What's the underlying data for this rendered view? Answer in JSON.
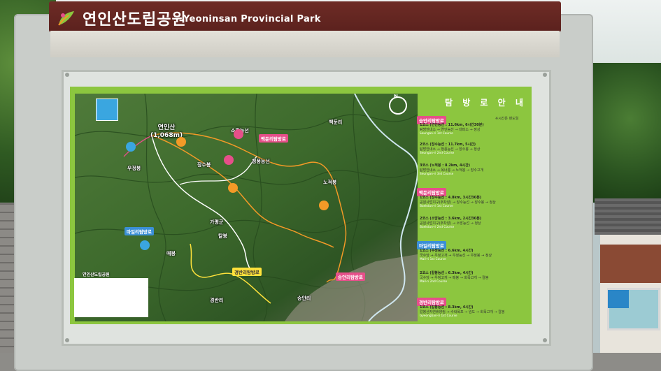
{
  "sign": {
    "title_ko": "연인산도립공원",
    "title_en": "Yeoninsan Provincial Park"
  },
  "map": {
    "peak_name": "연인산",
    "peak_height": "(1,068m)",
    "compass_n": "N",
    "labels": [
      "가평군",
      "경반리",
      "승안리",
      "백둔리",
      "우정봉",
      "매봉",
      "칼봉",
      "장수봉",
      "노적봉",
      "소망능선",
      "청풍능선"
    ],
    "trail_tags": [
      "승안리탐방로",
      "백둔리탐방로",
      "마일리탐방로",
      "경반리탐방로"
    ],
    "desc_title": "연인산도립공원"
  },
  "guide": {
    "title": "탐 방 로 안 내",
    "note": "※시간은 편도임",
    "sections": [
      {
        "tag": "승안리탐방로",
        "courses": [
          {
            "head": "1코스 (연인능선 : 11.6km, 6시간30분)",
            "route": "탐방안내소 → 연인능선 → 대피소 → 정상",
            "en": "Seungan-ri 1st Course"
          },
          {
            "head": "2코스 (장수능선 : 11.7km, 5시간)",
            "route": "탐방안내소 → 청풍능선 → 장수봉 → 정상",
            "en": "Seungan-ri 2nd Course"
          },
          {
            "head": "3코스 (노적봉 : 8.2km, 4시간)",
            "route": "탐방안내소 → 목너릉 → 노적봉 → 장수고개",
            "en": "Seungan-ri 3rd Course"
          }
        ]
      },
      {
        "tag": "백둔리탐방로",
        "courses": [
          {
            "head": "1코스 (장수능선 : 4.8km, 3시간30분)",
            "route": "공원사업지구(주차장) → 장수능선 → 장수봉 → 정상",
            "en": "Baekdun-ri 1st Course"
          },
          {
            "head": "2코스 (소망능선 : 3.6km, 2시간30분)",
            "route": "공원사업지구(주차장) → 소망능선 → 정상",
            "en": "Baekdun-ri 2nd Course"
          }
        ]
      },
      {
        "tag": "마일리탐방로",
        "courses": [
          {
            "head": "1코스 (우정능선 : 6.6km, 4시간)",
            "route": "국수당 → 우정고개 → 우정능선 → 우정봉 → 정상",
            "en": "Mail-ri 1st Course"
          },
          {
            "head": "2코스 (칼봉능선 : 6.3km, 4시간)",
            "route": "국수당 → 우정고개 → 매봉 → 회목고개 → 칼봉",
            "en": "Mail-ri 2nd Course"
          }
        ]
      },
      {
        "tag": "경반리탐방로",
        "courses": [
          {
            "head": "1코스 (칼봉능선 : 8.3km, 4시간)",
            "route": "칼봉산자연휴양림 → 수락폭포 → 임도 → 회목고개 → 칼봉",
            "en": "Gyeongban-ri 1st Course"
          }
        ]
      }
    ]
  },
  "colors": {
    "header": "#6e2c26",
    "board_green": "#8cc63f",
    "trail_orange": "#f39a27",
    "trail_white": "#ffffff",
    "trail_yellow": "#ffe23b"
  }
}
